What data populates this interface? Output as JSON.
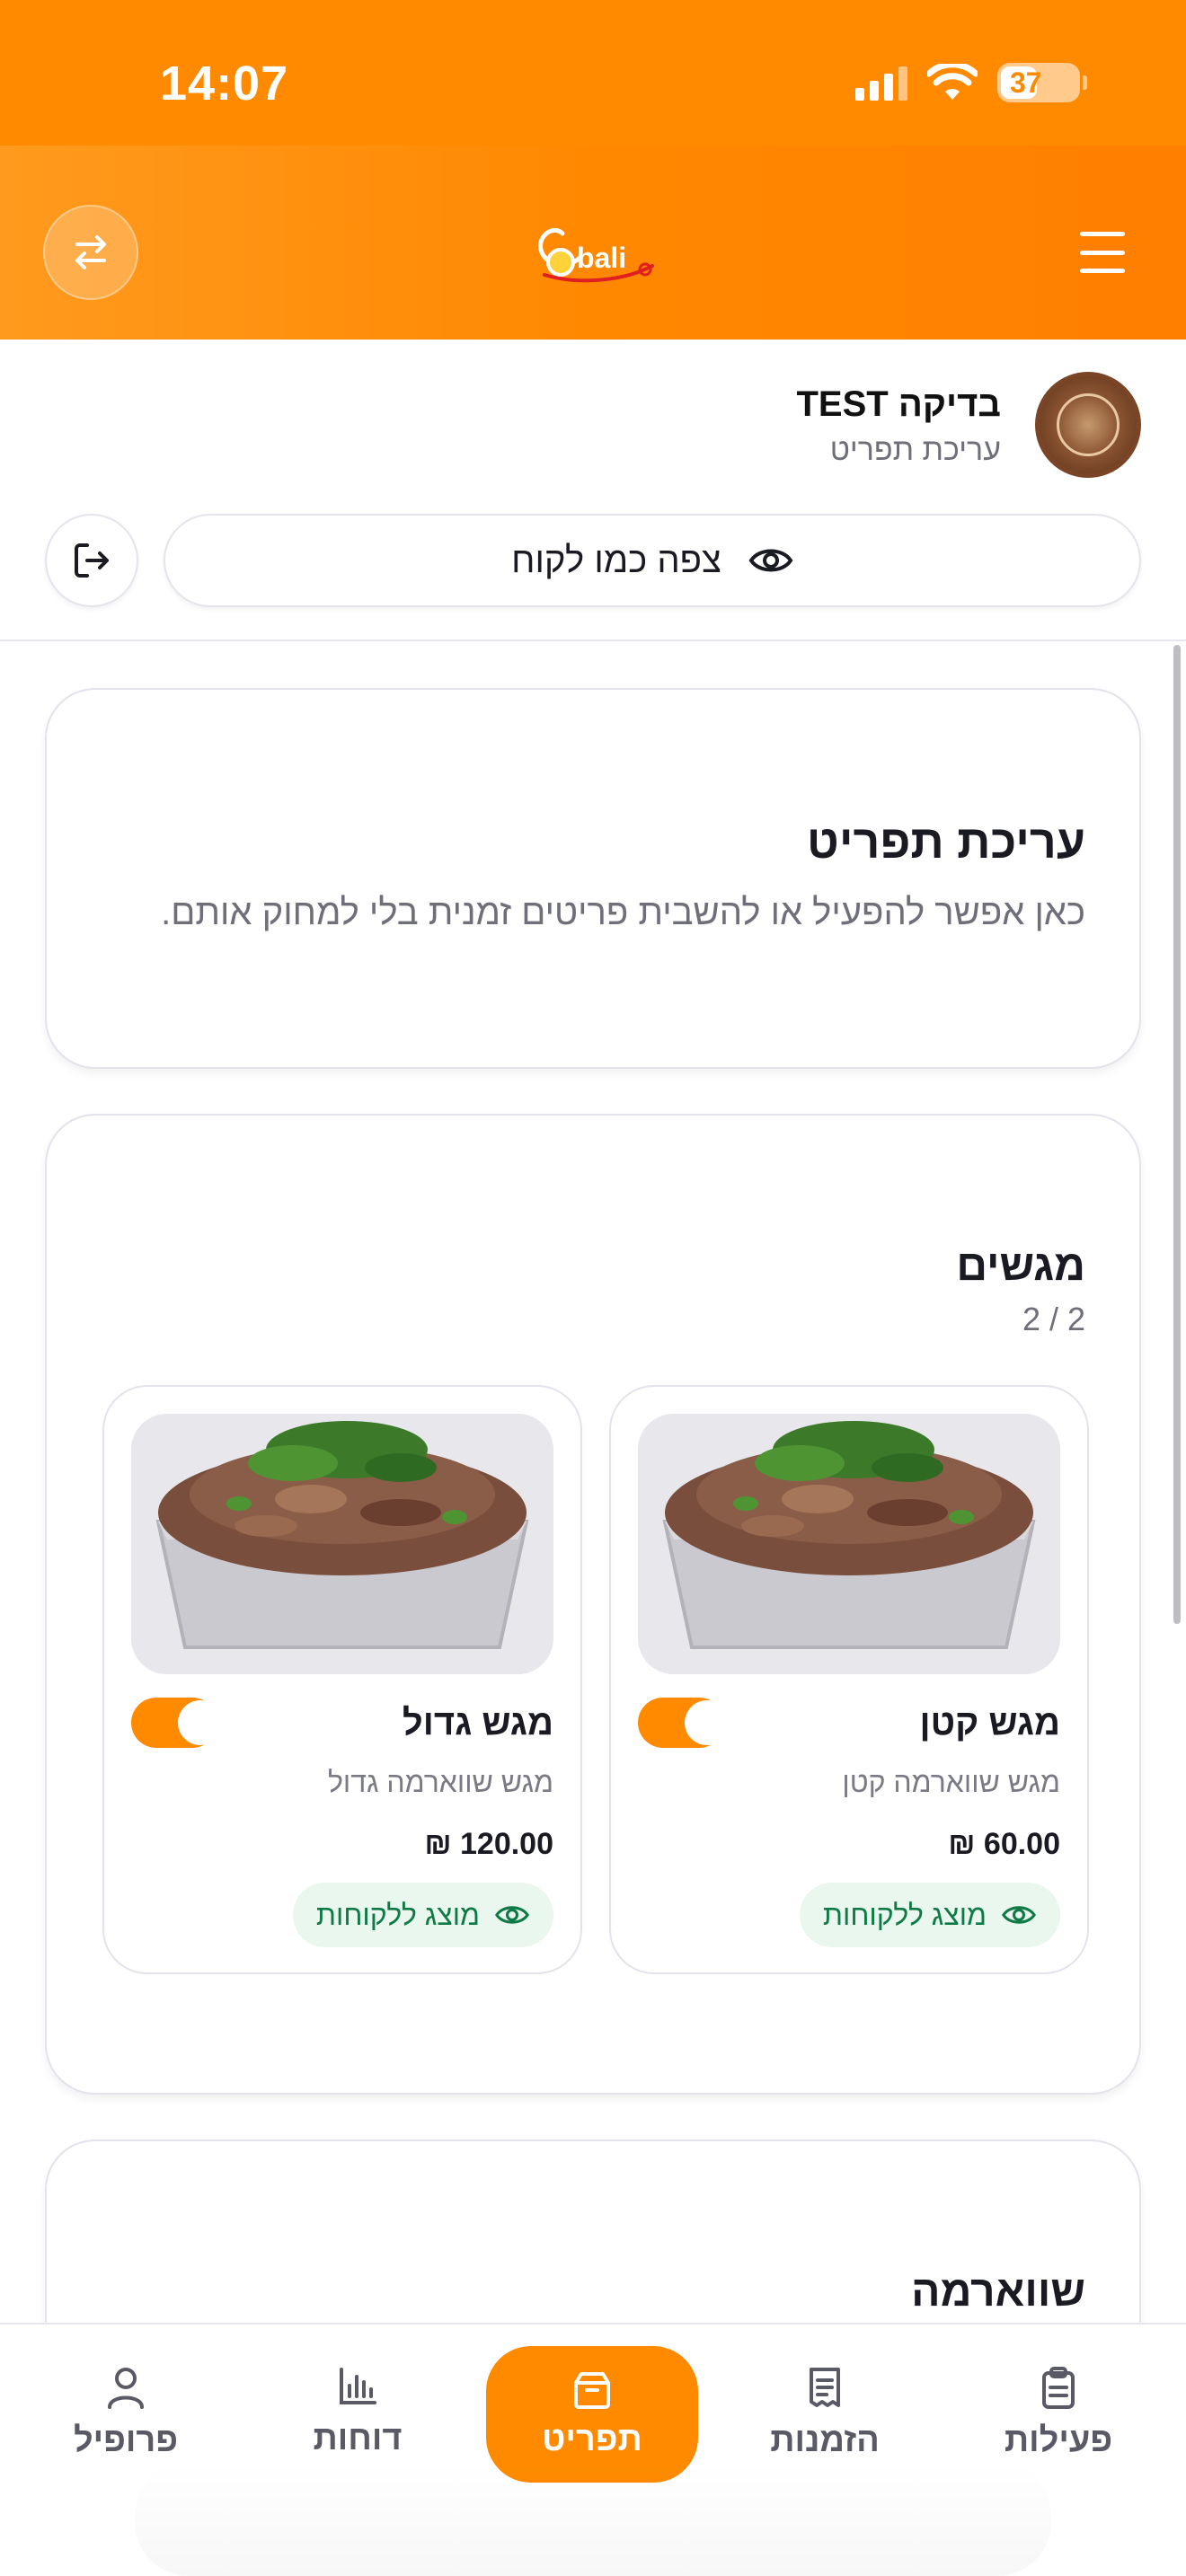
{
  "status_bar": {
    "time": "14:07",
    "battery": "37"
  },
  "header": {
    "logo_text": "bali"
  },
  "restaurant": {
    "name": "בדיקה TEST",
    "subtitle": "עריכת תפריט",
    "view_as_customer": "צפה כמו לקוח"
  },
  "intro": {
    "title": "עריכת תפריט",
    "description": "כאן אפשר להפעיל או להשבית פריטים זמנית בלי למחוק אותם."
  },
  "section_trays": {
    "title": "מגשים",
    "count": "2 / 2",
    "items": [
      {
        "title": "מגש קטן",
        "description": "מגש שווארמה קטן",
        "price": "₪ 60.00",
        "badge": "מוצג ללקוחות",
        "enabled": true
      },
      {
        "title": "מגש גדול",
        "description": "מגש שווארמה גדול",
        "price": "₪ 120.00",
        "badge": "מוצג ללקוחות",
        "enabled": true
      }
    ]
  },
  "section_shawarma": {
    "title": "שווארמה"
  },
  "bottom_nav": {
    "items": [
      {
        "label": "פעילות",
        "icon": "clipboard-icon"
      },
      {
        "label": "הזמנות",
        "icon": "receipt-icon"
      },
      {
        "label": "תפריט",
        "icon": "box-icon",
        "active": true
      },
      {
        "label": "דוחות",
        "icon": "bar-chart-icon"
      },
      {
        "label": "פרופיל",
        "icon": "user-icon"
      }
    ]
  },
  "colors": {
    "accent": "#ff8a00",
    "badge_bg": "#e9f7ef",
    "badge_text": "#0f7a45"
  }
}
